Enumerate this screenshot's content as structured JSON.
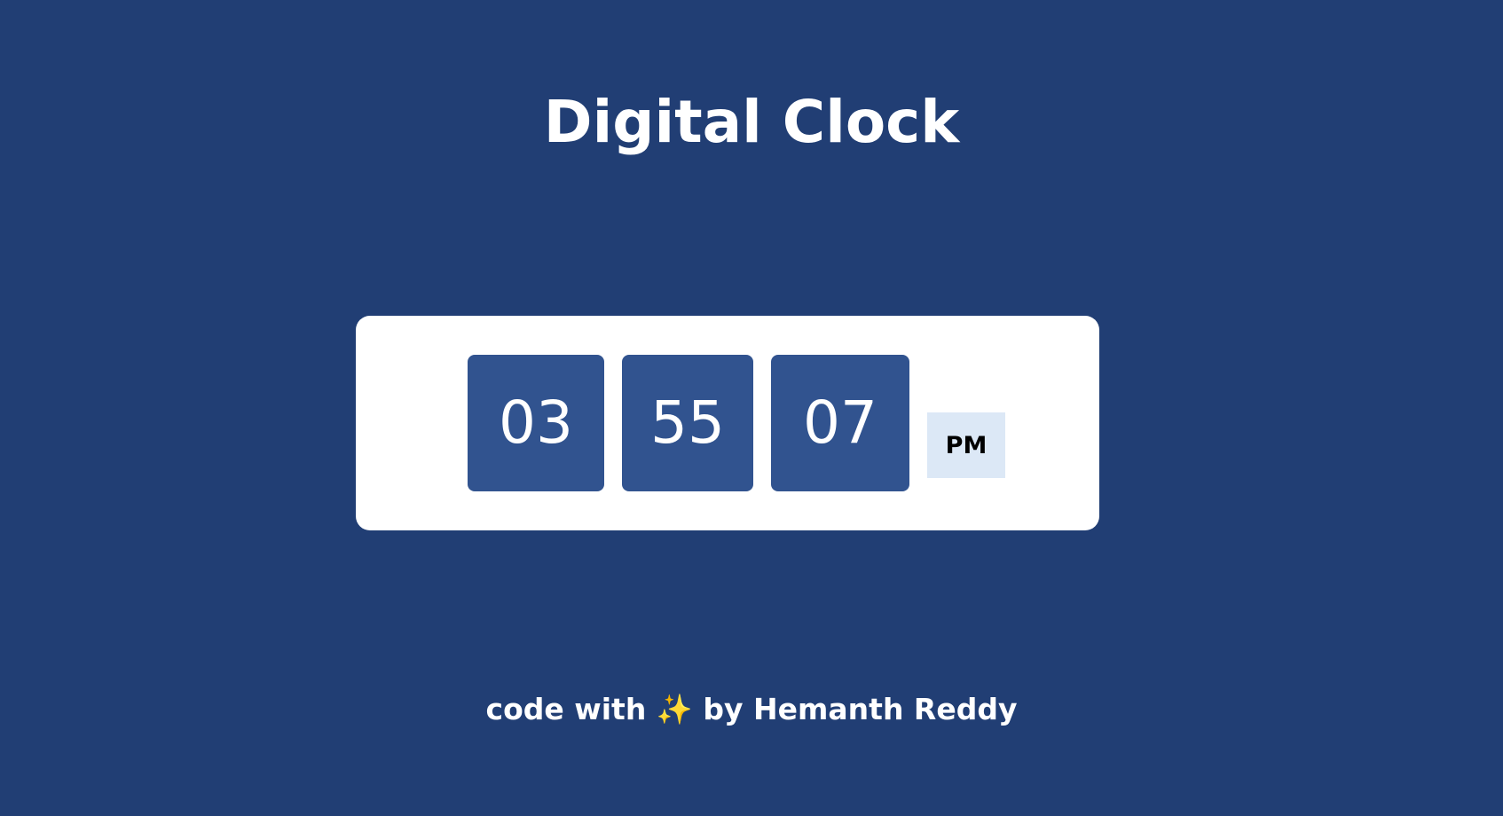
{
  "page": {
    "title": "Digital Clock",
    "background_color": "#213e74"
  },
  "clock": {
    "hours": "03",
    "minutes": "55",
    "seconds": "07",
    "period": "PM",
    "card_color": "#ffffff",
    "box_color": "#31538f",
    "period_bg_color": "#dce8f6"
  },
  "footer": {
    "prefix": "code with",
    "sparkle": "✨",
    "sparkle_icon": "sparkles-icon",
    "suffix": "by Hemanth Reddy"
  }
}
